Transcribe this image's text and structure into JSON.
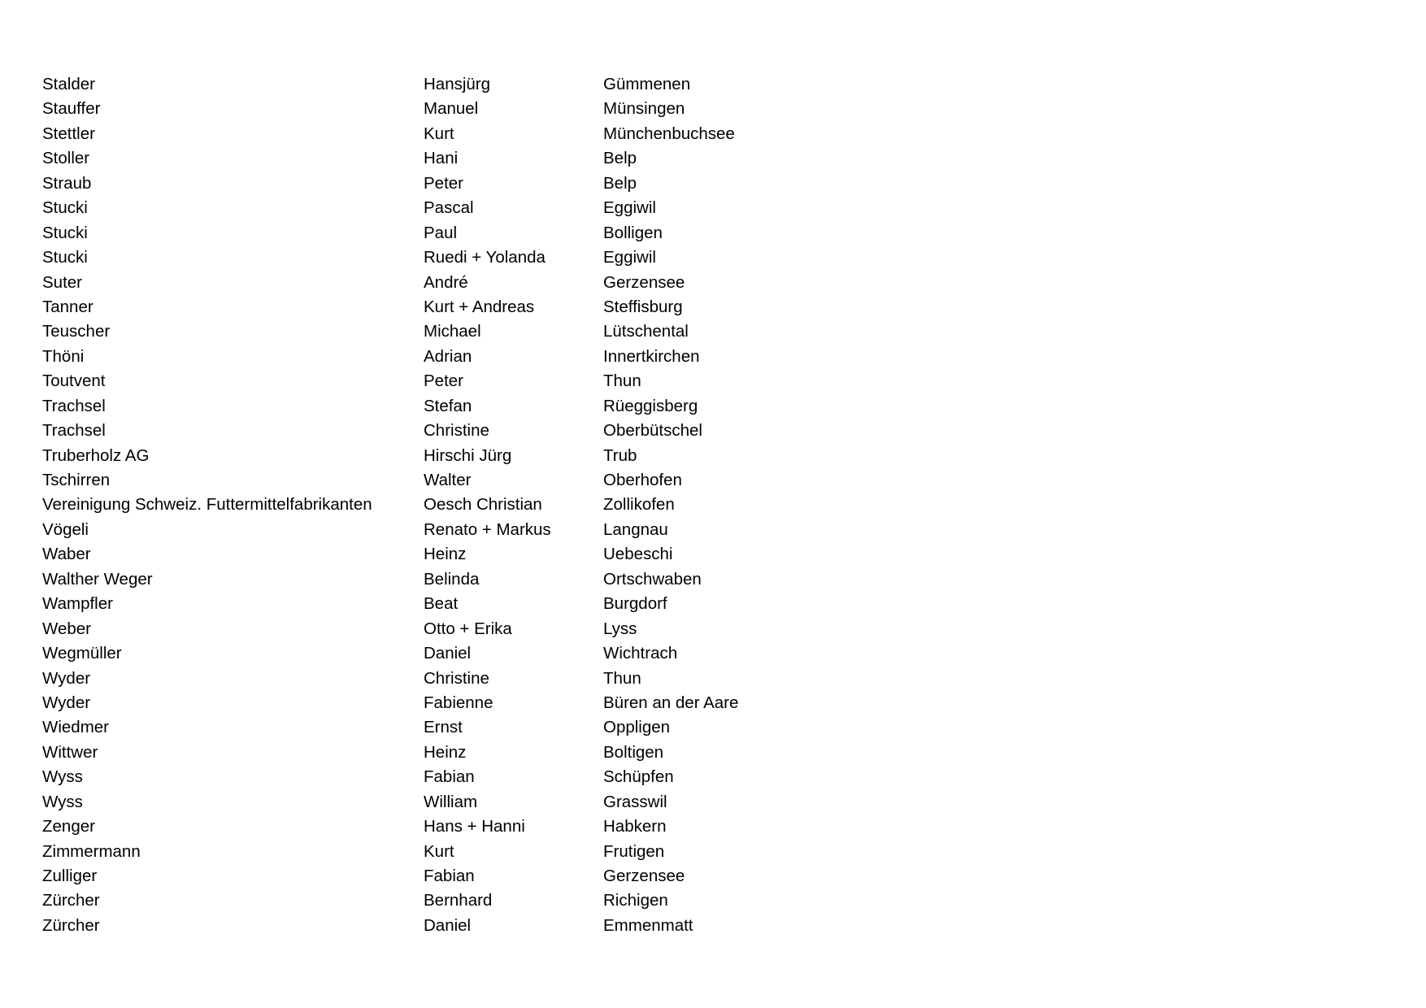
{
  "rows": [
    [
      "Stalder",
      "Hansjürg",
      "Gümmenen"
    ],
    [
      "Stauffer",
      "Manuel",
      "Münsingen"
    ],
    [
      "Stettler",
      "Kurt",
      "Münchenbuchsee"
    ],
    [
      "Stoller",
      "Hani",
      "Belp"
    ],
    [
      "Straub",
      "Peter",
      "Belp"
    ],
    [
      "Stucki",
      "Pascal",
      "Eggiwil"
    ],
    [
      "Stucki",
      "Paul",
      "Bolligen"
    ],
    [
      "Stucki",
      "Ruedi + Yolanda",
      "Eggiwil"
    ],
    [
      "Suter",
      "André",
      "Gerzensee"
    ],
    [
      "Tanner",
      "Kurt + Andreas",
      "Steffisburg"
    ],
    [
      "Teuscher",
      "Michael",
      "Lütschental"
    ],
    [
      "Thöni",
      "Adrian",
      "Innertkirchen"
    ],
    [
      "Toutvent",
      "Peter",
      "Thun"
    ],
    [
      "Trachsel",
      "Stefan",
      "Rüeggisberg"
    ],
    [
      "Trachsel",
      "Christine",
      "Oberbütschel"
    ],
    [
      "Truberholz AG",
      "Hirschi Jürg",
      "Trub"
    ],
    [
      "Tschirren",
      "Walter",
      "Oberhofen"
    ],
    [
      "Vereinigung Schweiz. Futtermittelfabrikanten",
      "Oesch Christian",
      "Zollikofen"
    ],
    [
      "Vögeli",
      "Renato + Markus",
      "Langnau"
    ],
    [
      "Waber",
      "Heinz",
      "Uebeschi"
    ],
    [
      "Walther Weger",
      "Belinda",
      "Ortschwaben"
    ],
    [
      "Wampfler",
      "Beat",
      "Burgdorf"
    ],
    [
      "Weber",
      "Otto + Erika",
      "Lyss"
    ],
    [
      "Wegmüller",
      "Daniel",
      "Wichtrach"
    ],
    [
      "Wyder",
      "Christine",
      "Thun"
    ],
    [
      "Wyder",
      "Fabienne",
      "Büren an der Aare"
    ],
    [
      "Wiedmer",
      "Ernst",
      "Oppligen"
    ],
    [
      "Wittwer",
      "Heinz",
      "Boltigen"
    ],
    [
      "Wyss",
      "Fabian",
      "Schüpfen"
    ],
    [
      "Wyss",
      "William",
      "Grasswil"
    ],
    [
      "Zenger",
      "Hans + Hanni",
      "Habkern"
    ],
    [
      "Zimmermann",
      "Kurt",
      "Frutigen"
    ],
    [
      "Zulliger",
      "Fabian",
      "Gerzensee"
    ],
    [
      "Zürcher",
      "Bernhard",
      "Richigen"
    ],
    [
      "Zürcher",
      "Daniel",
      "Emmenmatt"
    ]
  ]
}
